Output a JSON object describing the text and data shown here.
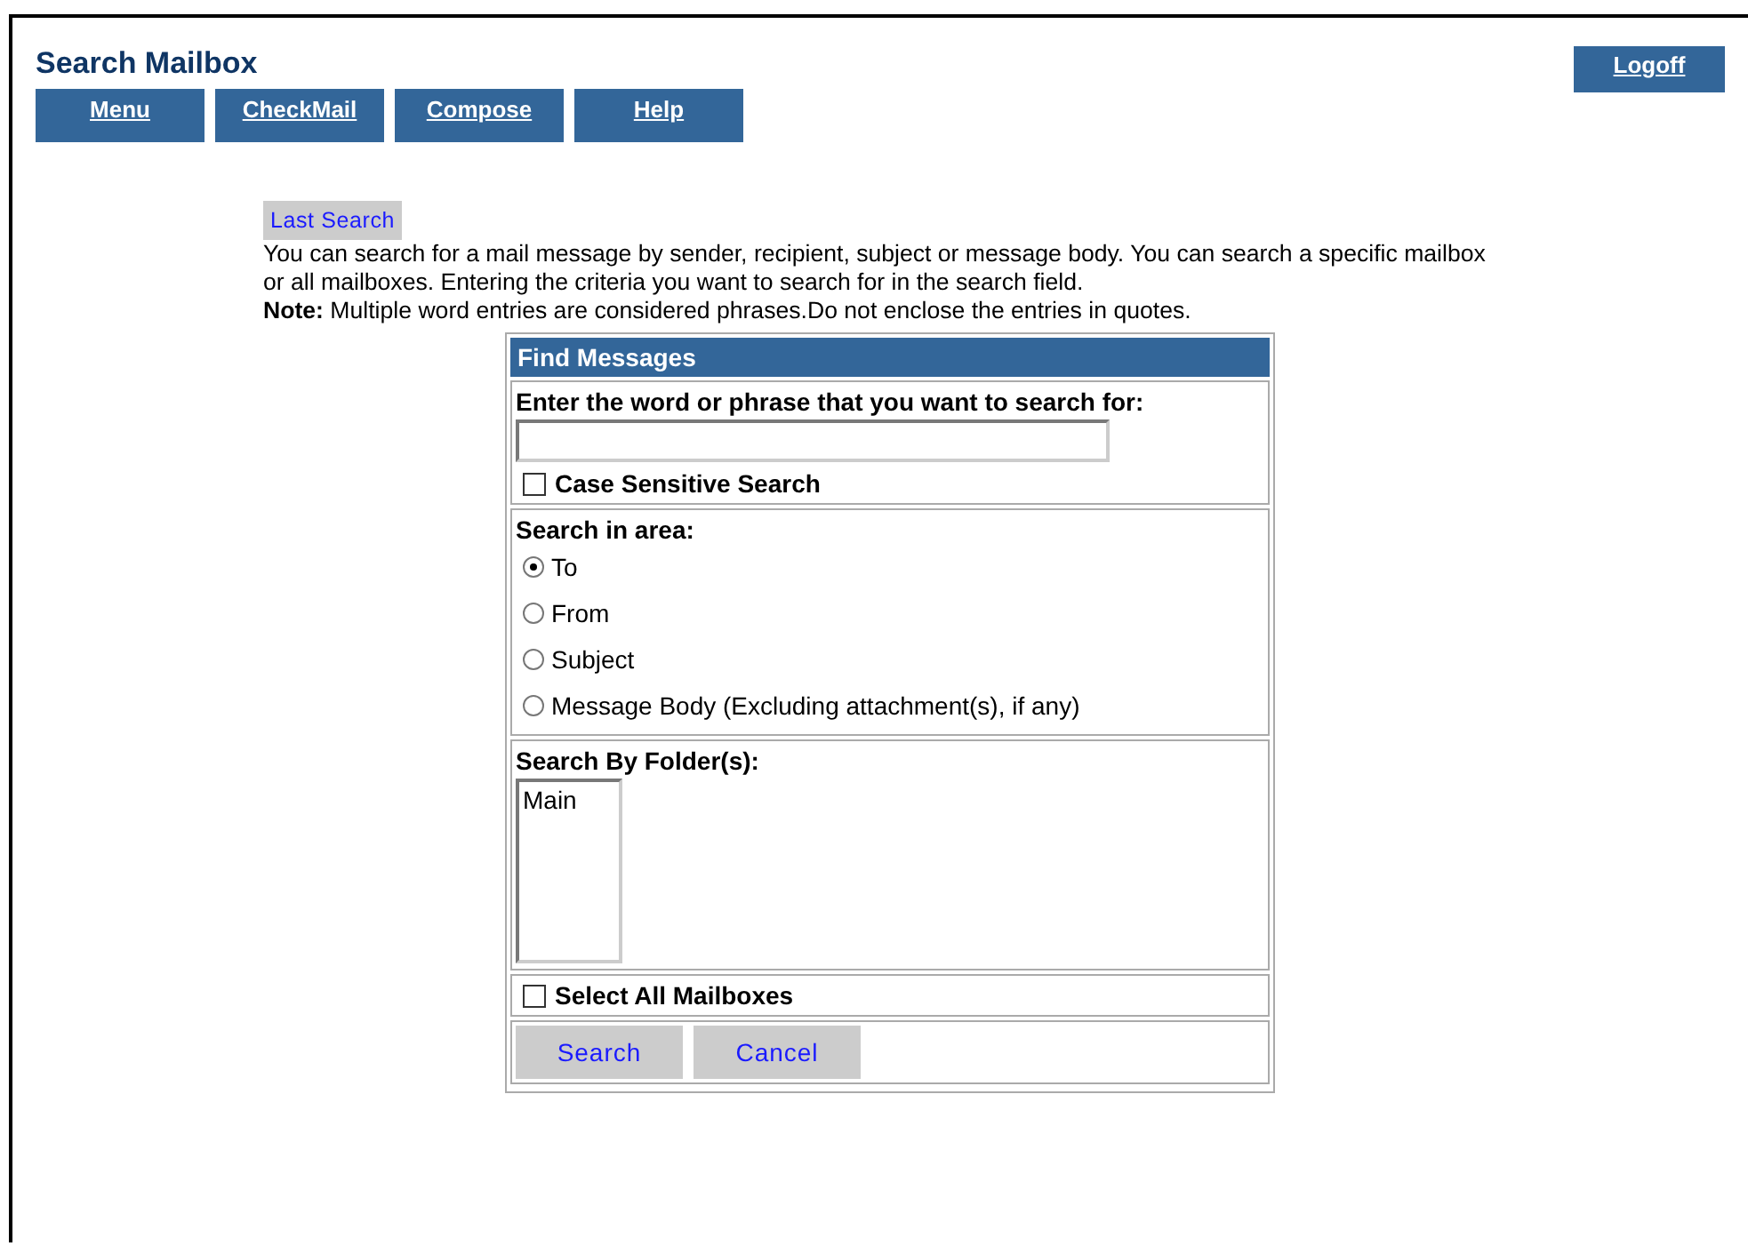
{
  "title": "Search Mailbox",
  "nav": [
    {
      "label": "Menu"
    },
    {
      "label": "CheckMail"
    },
    {
      "label": "Compose"
    },
    {
      "label": "Help"
    }
  ],
  "logoff": "Logoff",
  "last_search": "Last Search",
  "intro": "You can search for a mail message by sender, recipient, subject or message body. You can search a specific mailbox or all mailboxes. Entering the criteria you want to search for in the search field.",
  "note": "**Note:** Multiple word entries are considered phrases.Do not enclose the entries in quotes.",
  "form": {
    "title": "Find Messages",
    "query_label": "Enter the word or phrase that you want to search for:",
    "case_sensitive": {
      "label": "Case Sensitive Search",
      "checked": false
    },
    "area_label": "Search in area:",
    "areas": [
      {
        "label": "To",
        "selected": true
      },
      {
        "label": "From",
        "selected": false
      },
      {
        "label": "Subject",
        "selected": false
      },
      {
        "label": "Message Body (Excluding attachment(s), if any)",
        "selected": false
      }
    ],
    "folder_label": "Search By Folder(s):",
    "folders": [
      "Main"
    ],
    "select_all": {
      "label": "Select All Mailboxes",
      "checked": false
    },
    "buttons": [
      {
        "label": "Search"
      },
      {
        "label": "Cancel"
      }
    ]
  }
}
